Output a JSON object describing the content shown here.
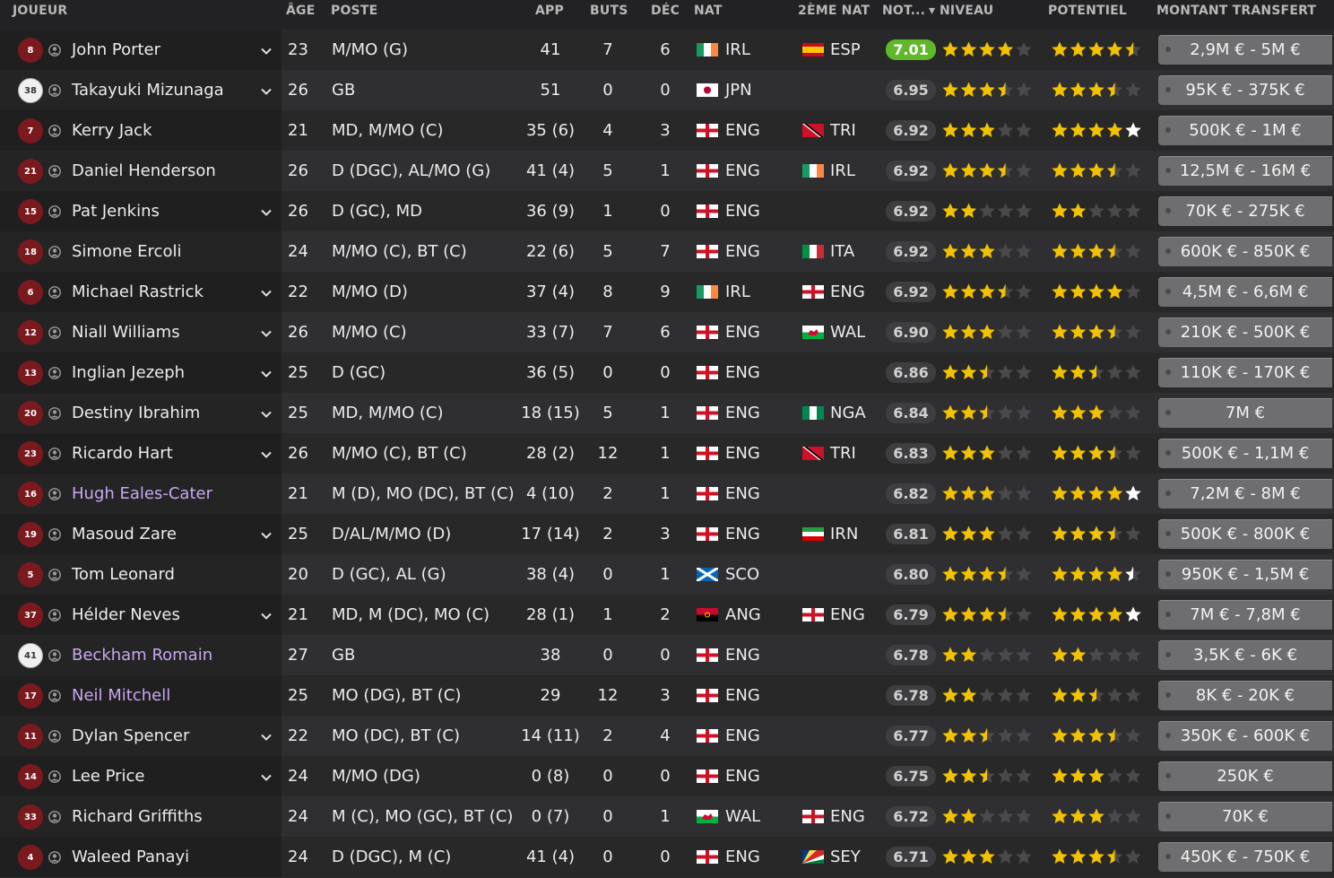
{
  "columns": {
    "player": "JOUEUR",
    "age": "ÂGE",
    "position": "POSTE",
    "apps": "APP",
    "goals": "BUTS",
    "assists": "DÉC",
    "nat": "NAT",
    "second_nat": "2ÈME NAT",
    "rating": "NOT...",
    "level": "NIVEAU",
    "potential": "POTENTIEL",
    "transfer": "MONTANT TRANSFERT"
  },
  "sort_indicator": "▾",
  "colors": {
    "star_full": "#f2c200",
    "star_empty": "#4a4a4c",
    "star_white": "#ffffff",
    "rating_hot": "#5fb82a",
    "shirt": "#7a1a1f",
    "purple_name": "#c8a8f0"
  },
  "players": [
    {
      "shirt": "8",
      "gk": false,
      "name": "John Porter",
      "purple": false,
      "chevron": true,
      "age": "23",
      "position": "M/MO (G)",
      "apps": "41",
      "goals": "7",
      "assists": "6",
      "nat": "IRL",
      "nat_flag": "irl",
      "nat2": "ESP",
      "nat2_flag": "esp",
      "rating": "7.01",
      "hot": true,
      "level": 4,
      "potential": 4.5,
      "potential_white": 0,
      "transfer": "2,9M € - 5M €"
    },
    {
      "shirt": "38",
      "gk": true,
      "name": "Takayuki Mizunaga",
      "purple": false,
      "chevron": true,
      "age": "26",
      "position": "GB",
      "apps": "51",
      "goals": "0",
      "assists": "0",
      "nat": "JPN",
      "nat_flag": "jpn",
      "nat2": "",
      "nat2_flag": "",
      "rating": "6.95",
      "hot": false,
      "level": 3.5,
      "potential": 3.5,
      "potential_white": 0,
      "transfer": "95K € - 375K €"
    },
    {
      "shirt": "7",
      "gk": false,
      "name": "Kerry Jack",
      "purple": false,
      "chevron": false,
      "age": "21",
      "position": "MD, M/MO (C)",
      "apps": "35 (6)",
      "goals": "4",
      "assists": "3",
      "nat": "ENG",
      "nat_flag": "eng",
      "nat2": "TRI",
      "nat2_flag": "tri",
      "rating": "6.92",
      "hot": false,
      "level": 3,
      "potential": 4,
      "potential_white": 1,
      "transfer": "500K € - 1M €"
    },
    {
      "shirt": "21",
      "gk": false,
      "name": "Daniel Henderson",
      "purple": false,
      "chevron": false,
      "age": "26",
      "position": "D (DGC), AL/MO (G)",
      "apps": "41 (4)",
      "goals": "5",
      "assists": "1",
      "nat": "ENG",
      "nat_flag": "eng",
      "nat2": "IRL",
      "nat2_flag": "irl",
      "rating": "6.92",
      "hot": false,
      "level": 3.5,
      "potential": 3.5,
      "potential_white": 0,
      "transfer": "12,5M € - 16M €"
    },
    {
      "shirt": "15",
      "gk": false,
      "name": "Pat Jenkins",
      "purple": false,
      "chevron": true,
      "age": "26",
      "position": "D (GC), MD",
      "apps": "36 (9)",
      "goals": "1",
      "assists": "0",
      "nat": "ENG",
      "nat_flag": "eng",
      "nat2": "",
      "nat2_flag": "",
      "rating": "6.92",
      "hot": false,
      "level": 2,
      "potential": 2,
      "potential_white": 0,
      "transfer": "70K € - 275K €"
    },
    {
      "shirt": "18",
      "gk": false,
      "name": "Simone Ercoli",
      "purple": false,
      "chevron": false,
      "age": "24",
      "position": "M/MO (C), BT (C)",
      "apps": "22 (6)",
      "goals": "5",
      "assists": "7",
      "nat": "ENG",
      "nat_flag": "eng",
      "nat2": "ITA",
      "nat2_flag": "ita",
      "rating": "6.92",
      "hot": false,
      "level": 3,
      "potential": 3.5,
      "potential_white": 0,
      "transfer": "600K € - 850K €"
    },
    {
      "shirt": "6",
      "gk": false,
      "name": "Michael Rastrick",
      "purple": false,
      "chevron": true,
      "age": "22",
      "position": "M/MO (D)",
      "apps": "37 (4)",
      "goals": "8",
      "assists": "9",
      "nat": "IRL",
      "nat_flag": "irl",
      "nat2": "ENG",
      "nat2_flag": "eng",
      "rating": "6.92",
      "hot": false,
      "level": 3.5,
      "potential": 4,
      "potential_white": 0,
      "transfer": "4,5M € - 6,6M €"
    },
    {
      "shirt": "12",
      "gk": false,
      "name": "Niall Williams",
      "purple": false,
      "chevron": true,
      "age": "26",
      "position": "M/MO (C)",
      "apps": "33 (7)",
      "goals": "7",
      "assists": "6",
      "nat": "ENG",
      "nat_flag": "eng",
      "nat2": "WAL",
      "nat2_flag": "wal",
      "rating": "6.90",
      "hot": false,
      "level": 3,
      "potential": 3.5,
      "potential_white": 0,
      "transfer": "210K € - 500K €"
    },
    {
      "shirt": "13",
      "gk": false,
      "name": "Inglian Jezeph",
      "purple": false,
      "chevron": true,
      "age": "25",
      "position": "D (GC)",
      "apps": "36 (5)",
      "goals": "0",
      "assists": "0",
      "nat": "ENG",
      "nat_flag": "eng",
      "nat2": "",
      "nat2_flag": "",
      "rating": "6.86",
      "hot": false,
      "level": 2.5,
      "potential": 2.5,
      "potential_white": 0,
      "transfer": "110K € - 170K €"
    },
    {
      "shirt": "20",
      "gk": false,
      "name": "Destiny Ibrahim",
      "purple": false,
      "chevron": true,
      "age": "25",
      "position": "MD, M/MO (C)",
      "apps": "18 (15)",
      "goals": "5",
      "assists": "1",
      "nat": "ENG",
      "nat_flag": "eng",
      "nat2": "NGA",
      "nat2_flag": "nga",
      "rating": "6.84",
      "hot": false,
      "level": 2.5,
      "potential": 3,
      "potential_white": 0,
      "transfer": "7M €"
    },
    {
      "shirt": "23",
      "gk": false,
      "name": "Ricardo Hart",
      "purple": false,
      "chevron": true,
      "age": "26",
      "position": "M/MO (C), BT (C)",
      "apps": "28 (2)",
      "goals": "12",
      "assists": "1",
      "nat": "ENG",
      "nat_flag": "eng",
      "nat2": "TRI",
      "nat2_flag": "tri",
      "rating": "6.83",
      "hot": false,
      "level": 3,
      "potential": 3.5,
      "potential_white": 0,
      "transfer": "500K € - 1,1M €"
    },
    {
      "shirt": "16",
      "gk": false,
      "name": "Hugh Eales-Cater",
      "purple": true,
      "chevron": false,
      "age": "21",
      "position": "M (D), MO (DC), BT (C)",
      "apps": "4 (10)",
      "goals": "2",
      "assists": "1",
      "nat": "ENG",
      "nat_flag": "eng",
      "nat2": "",
      "nat2_flag": "",
      "rating": "6.82",
      "hot": false,
      "level": 3,
      "potential": 4,
      "potential_white": 1,
      "transfer": "7,2M € - 8M €"
    },
    {
      "shirt": "19",
      "gk": false,
      "name": "Masoud Zare",
      "purple": false,
      "chevron": true,
      "age": "25",
      "position": "D/AL/M/MO (D)",
      "apps": "17 (14)",
      "goals": "2",
      "assists": "3",
      "nat": "ENG",
      "nat_flag": "eng",
      "nat2": "IRN",
      "nat2_flag": "irn",
      "rating": "6.81",
      "hot": false,
      "level": 3,
      "potential": 3.5,
      "potential_white": 0,
      "transfer": "500K € - 800K €"
    },
    {
      "shirt": "5",
      "gk": false,
      "name": "Tom Leonard",
      "purple": false,
      "chevron": false,
      "age": "20",
      "position": "D (GC), AL (G)",
      "apps": "38 (4)",
      "goals": "0",
      "assists": "1",
      "nat": "SCO",
      "nat_flag": "sco",
      "nat2": "",
      "nat2_flag": "",
      "rating": "6.80",
      "hot": false,
      "level": 3.5,
      "potential": 4,
      "potential_white": 0.5,
      "transfer": "950K € - 1,5M €"
    },
    {
      "shirt": "37",
      "gk": false,
      "name": "Hélder Neves",
      "purple": false,
      "chevron": true,
      "age": "21",
      "position": "MD, M (DC), MO (C)",
      "apps": "28 (1)",
      "goals": "1",
      "assists": "2",
      "nat": "ANG",
      "nat_flag": "ang",
      "nat2": "ENG",
      "nat2_flag": "eng",
      "rating": "6.79",
      "hot": false,
      "level": 3.5,
      "potential": 4,
      "potential_white": 1,
      "transfer": "7M € - 7,8M €"
    },
    {
      "shirt": "41",
      "gk": true,
      "name": "Beckham Romain",
      "purple": true,
      "chevron": false,
      "age": "27",
      "position": "GB",
      "apps": "38",
      "goals": "0",
      "assists": "0",
      "nat": "ENG",
      "nat_flag": "eng",
      "nat2": "",
      "nat2_flag": "",
      "rating": "6.78",
      "hot": false,
      "level": 2,
      "potential": 2,
      "potential_white": 0,
      "transfer": "3,5K € - 6K €"
    },
    {
      "shirt": "17",
      "gk": false,
      "name": "Neil Mitchell",
      "purple": true,
      "chevron": false,
      "age": "25",
      "position": "MO (DG), BT (C)",
      "apps": "29",
      "goals": "12",
      "assists": "3",
      "nat": "ENG",
      "nat_flag": "eng",
      "nat2": "",
      "nat2_flag": "",
      "rating": "6.78",
      "hot": false,
      "level": 2,
      "potential": 2.5,
      "potential_white": 0,
      "transfer": "8K € - 20K €"
    },
    {
      "shirt": "11",
      "gk": false,
      "name": "Dylan Spencer",
      "purple": false,
      "chevron": true,
      "age": "22",
      "position": "MO (DC), BT (C)",
      "apps": "14 (11)",
      "goals": "2",
      "assists": "4",
      "nat": "ENG",
      "nat_flag": "eng",
      "nat2": "",
      "nat2_flag": "",
      "rating": "6.77",
      "hot": false,
      "level": 2.5,
      "potential": 3.5,
      "potential_white": 0,
      "transfer": "350K € - 600K €"
    },
    {
      "shirt": "14",
      "gk": false,
      "name": "Lee Price",
      "purple": false,
      "chevron": true,
      "age": "24",
      "position": "M/MO (DG)",
      "apps": "0 (8)",
      "goals": "0",
      "assists": "0",
      "nat": "ENG",
      "nat_flag": "eng",
      "nat2": "",
      "nat2_flag": "",
      "rating": "6.75",
      "hot": false,
      "level": 2.5,
      "potential": 3,
      "potential_white": 0,
      "transfer": "250K €"
    },
    {
      "shirt": "33",
      "gk": false,
      "name": "Richard Griffiths",
      "purple": false,
      "chevron": false,
      "age": "24",
      "position": "M (C), MO (GC), BT (C)",
      "apps": "0 (7)",
      "goals": "0",
      "assists": "1",
      "nat": "WAL",
      "nat_flag": "wal",
      "nat2": "ENG",
      "nat2_flag": "eng",
      "rating": "6.72",
      "hot": false,
      "level": 2,
      "potential": 3,
      "potential_white": 0,
      "transfer": "70K €"
    },
    {
      "shirt": "4",
      "gk": false,
      "name": "Waleed Panayi",
      "purple": false,
      "chevron": false,
      "age": "24",
      "position": "D (DGC), M (C)",
      "apps": "41 (4)",
      "goals": "0",
      "assists": "0",
      "nat": "ENG",
      "nat_flag": "eng",
      "nat2": "SEY",
      "nat2_flag": "sey",
      "rating": "6.71",
      "hot": false,
      "level": 3,
      "potential": 3.5,
      "potential_white": 0,
      "transfer": "450K € - 750K €"
    }
  ]
}
